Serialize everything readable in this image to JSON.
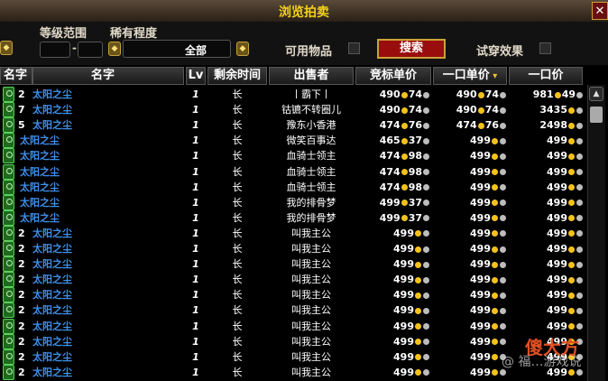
{
  "window": {
    "title": "浏览拍卖",
    "close_label": "✕"
  },
  "filters": {
    "level_label": "等级范围",
    "level_sep": "-",
    "rarity_label": "稀有程度",
    "rarity_value": "全部",
    "usable_label": "可用物品",
    "search_label": "搜索",
    "dressup_label": "试穿效果"
  },
  "columns": {
    "name": "名字",
    "name2": "名字",
    "lv": "Lv",
    "time": "剩余时间",
    "seller": "出售者",
    "bid": "竞标单价",
    "buyout_unit": "一口单价",
    "buyout": "一口价"
  },
  "rows": [
    {
      "count": "2",
      "name": "太阳之尘",
      "lv": "1",
      "time": "长",
      "seller": "丨霸下丨",
      "bid_g": "490",
      "bid_s": "74",
      "bo_g": "490",
      "bo_s": "74",
      "total_g": "981",
      "total_s": "49"
    },
    {
      "count": "7",
      "name": "太阳之尘",
      "lv": "1",
      "time": "长",
      "seller": "钴镳不转圈儿",
      "bid_g": "490",
      "bid_s": "74",
      "bo_g": "490",
      "bo_s": "74",
      "total_g": "3435",
      "total_s": ""
    },
    {
      "count": "5",
      "name": "太阳之尘",
      "lv": "1",
      "time": "长",
      "seller": "豫东小香港",
      "bid_g": "474",
      "bid_s": "76",
      "bo_g": "474",
      "bo_s": "76",
      "total_g": "2498",
      "total_s": ""
    },
    {
      "count": "",
      "name": "太阳之尘",
      "lv": "1",
      "time": "长",
      "seller": "微笑百事达",
      "bid_g": "465",
      "bid_s": "37",
      "bo_g": "499",
      "bo_s": "",
      "total_g": "499",
      "total_s": ""
    },
    {
      "count": "",
      "name": "太阳之尘",
      "lv": "1",
      "time": "长",
      "seller": "血骑士领主",
      "bid_g": "474",
      "bid_s": "98",
      "bo_g": "499",
      "bo_s": "",
      "total_g": "499",
      "total_s": ""
    },
    {
      "count": "",
      "name": "太阳之尘",
      "lv": "1",
      "time": "长",
      "seller": "血骑士领主",
      "bid_g": "474",
      "bid_s": "98",
      "bo_g": "499",
      "bo_s": "",
      "total_g": "499",
      "total_s": ""
    },
    {
      "count": "",
      "name": "太阳之尘",
      "lv": "1",
      "time": "长",
      "seller": "血骑士领主",
      "bid_g": "474",
      "bid_s": "98",
      "bo_g": "499",
      "bo_s": "",
      "total_g": "499",
      "total_s": ""
    },
    {
      "count": "",
      "name": "太阳之尘",
      "lv": "1",
      "time": "长",
      "seller": "我的排骨梦",
      "bid_g": "499",
      "bid_s": "37",
      "bo_g": "499",
      "bo_s": "",
      "total_g": "499",
      "total_s": ""
    },
    {
      "count": "",
      "name": "太阳之尘",
      "lv": "1",
      "time": "长",
      "seller": "我的排骨梦",
      "bid_g": "499",
      "bid_s": "37",
      "bo_g": "499",
      "bo_s": "",
      "total_g": "499",
      "total_s": ""
    },
    {
      "count": "2",
      "name": "太阳之尘",
      "lv": "1",
      "time": "长",
      "seller": "叫我主公",
      "bid_g": "499",
      "bid_s": "",
      "bo_g": "499",
      "bo_s": "",
      "total_g": "499",
      "total_s": ""
    },
    {
      "count": "2",
      "name": "太阳之尘",
      "lv": "1",
      "time": "长",
      "seller": "叫我主公",
      "bid_g": "499",
      "bid_s": "",
      "bo_g": "499",
      "bo_s": "",
      "total_g": "499",
      "total_s": ""
    },
    {
      "count": "2",
      "name": "太阳之尘",
      "lv": "1",
      "time": "长",
      "seller": "叫我主公",
      "bid_g": "499",
      "bid_s": "",
      "bo_g": "499",
      "bo_s": "",
      "total_g": "499",
      "total_s": ""
    },
    {
      "count": "2",
      "name": "太阳之尘",
      "lv": "1",
      "time": "长",
      "seller": "叫我主公",
      "bid_g": "499",
      "bid_s": "",
      "bo_g": "499",
      "bo_s": "",
      "total_g": "499",
      "total_s": ""
    },
    {
      "count": "2",
      "name": "太阳之尘",
      "lv": "1",
      "time": "长",
      "seller": "叫我主公",
      "bid_g": "499",
      "bid_s": "",
      "bo_g": "499",
      "bo_s": "",
      "total_g": "499",
      "total_s": ""
    },
    {
      "count": "2",
      "name": "太阳之尘",
      "lv": "1",
      "time": "长",
      "seller": "叫我主公",
      "bid_g": "499",
      "bid_s": "",
      "bo_g": "499",
      "bo_s": "",
      "total_g": "499",
      "total_s": ""
    },
    {
      "count": "2",
      "name": "太阳之尘",
      "lv": "1",
      "time": "长",
      "seller": "叫我主公",
      "bid_g": "499",
      "bid_s": "",
      "bo_g": "499",
      "bo_s": "",
      "total_g": "499",
      "total_s": ""
    },
    {
      "count": "2",
      "name": "太阳之尘",
      "lv": "1",
      "time": "长",
      "seller": "叫我主公",
      "bid_g": "499",
      "bid_s": "",
      "bo_g": "499",
      "bo_s": "",
      "total_g": "499",
      "total_s": ""
    },
    {
      "count": "2",
      "name": "太阳之尘",
      "lv": "1",
      "time": "长",
      "seller": "叫我主公",
      "bid_g": "499",
      "bid_s": "",
      "bo_g": "499",
      "bo_s": "",
      "total_g": "499",
      "total_s": ""
    },
    {
      "count": "2",
      "name": "太阳之尘",
      "lv": "1",
      "time": "长",
      "seller": "叫我主公",
      "bid_g": "499",
      "bid_s": "",
      "bo_g": "499",
      "bo_s": "",
      "total_g": "499",
      "total_s": ""
    }
  ],
  "icons": {
    "item": "sun-dust-item-icon",
    "gold": "gold-coin-icon",
    "silver": "silver-coin-icon",
    "sort": "sort-arrow-icon"
  },
  "colors": {
    "title": "#f2d21a",
    "item_name": "#3f8fe8",
    "search_button": "#9a0d0d",
    "gold": "#f4c21c"
  },
  "watermark": {
    "text": "@ 福…游戏说",
    "logo": "傻大方"
  }
}
